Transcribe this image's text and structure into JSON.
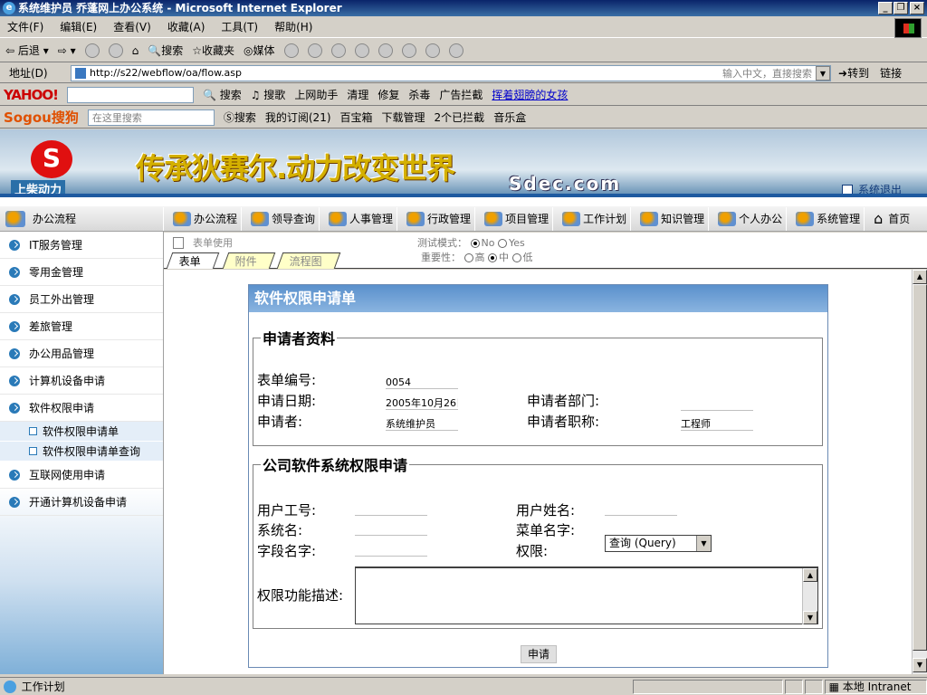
{
  "window": {
    "title": "系统维护员 乔蓬网上办公系统 - Microsoft Internet Explorer"
  },
  "menubar": [
    "文件(F)",
    "编辑(E)",
    "查看(V)",
    "收藏(A)",
    "工具(T)",
    "帮助(H)"
  ],
  "toolbar": {
    "back": "后退",
    "search": "搜索",
    "favorites": "收藏夹",
    "media": "媒体"
  },
  "address": {
    "label": "地址(D)",
    "url": "http://s22/webflow/oa/flow.asp",
    "hint": "输入中文，直接搜索",
    "go": "转到",
    "links": "链接"
  },
  "yahoo": {
    "logo": "YAHOO!",
    "search": "搜索",
    "song": "搜歌",
    "helper": "上网助手",
    "clean": "清理",
    "repair": "修复",
    "kill": "杀毒",
    "adblock": "广告拦截",
    "link": "挥着翅膀的女孩"
  },
  "sogou": {
    "logo": "Sogou搜狗",
    "placeholder": "在这里搜索",
    "search": "搜索",
    "subscribe": "我的订阅(21)",
    "box": "百宝箱",
    "download": "下载管理",
    "blocked": "2个已拦截",
    "music": "音乐盒"
  },
  "banner": {
    "logo_name": "上柴动力",
    "slogan": "传承狄赛尔.动力改变世界",
    "site": "Sdec.com",
    "logout": "系统退出"
  },
  "nav": [
    "办公流程",
    "领导查询",
    "人事管理",
    "行政管理",
    "项目管理",
    "工作计划",
    "知识管理",
    "个人办公",
    "系统管理",
    "首页"
  ],
  "sidebar": {
    "header": "办公流程",
    "items": [
      "IT服务管理",
      "零用金管理",
      "员工外出管理",
      "差旅管理",
      "办公用品管理",
      "计算机设备申请",
      "软件权限申请"
    ],
    "subitems": [
      "软件权限申请单",
      "软件权限申请单查询"
    ],
    "items_after": [
      "互联网使用申请",
      "开通计算机设备申请"
    ]
  },
  "formstrip": {
    "label": "表单使用",
    "tabs": [
      "表单",
      "附件",
      "流程图"
    ],
    "test_mode_label": "测试模式：",
    "test_no": "No",
    "test_yes": "Yes",
    "importance_label": "重要性：",
    "high": "高",
    "mid": "中",
    "low": "低"
  },
  "form": {
    "title": "软件权限申请单",
    "applicant_legend": "申请者资料",
    "form_no_label": "表单编号:",
    "form_no": "0054",
    "date_label": "申请日期:",
    "date": "2005年10月26日",
    "dept_label": "申请者部门:",
    "applicant_label": "申请者:",
    "applicant": "系统维护员",
    "title_label": "申请者职称:",
    "job_title": "工程师",
    "perm_legend": "公司软件系统权限申请",
    "user_id_label": "用户工号:",
    "user_name_label": "用户姓名:",
    "system_label": "系统名:",
    "menu_label": "菜单名字:",
    "field_label": "字段名字:",
    "perm_label": "权限:",
    "perm_value": "查询 (Query)",
    "desc_label": "权限功能描述:",
    "apply_button": "申请"
  },
  "status": {
    "left": "工作计划",
    "zone": "本地 Intranet"
  }
}
